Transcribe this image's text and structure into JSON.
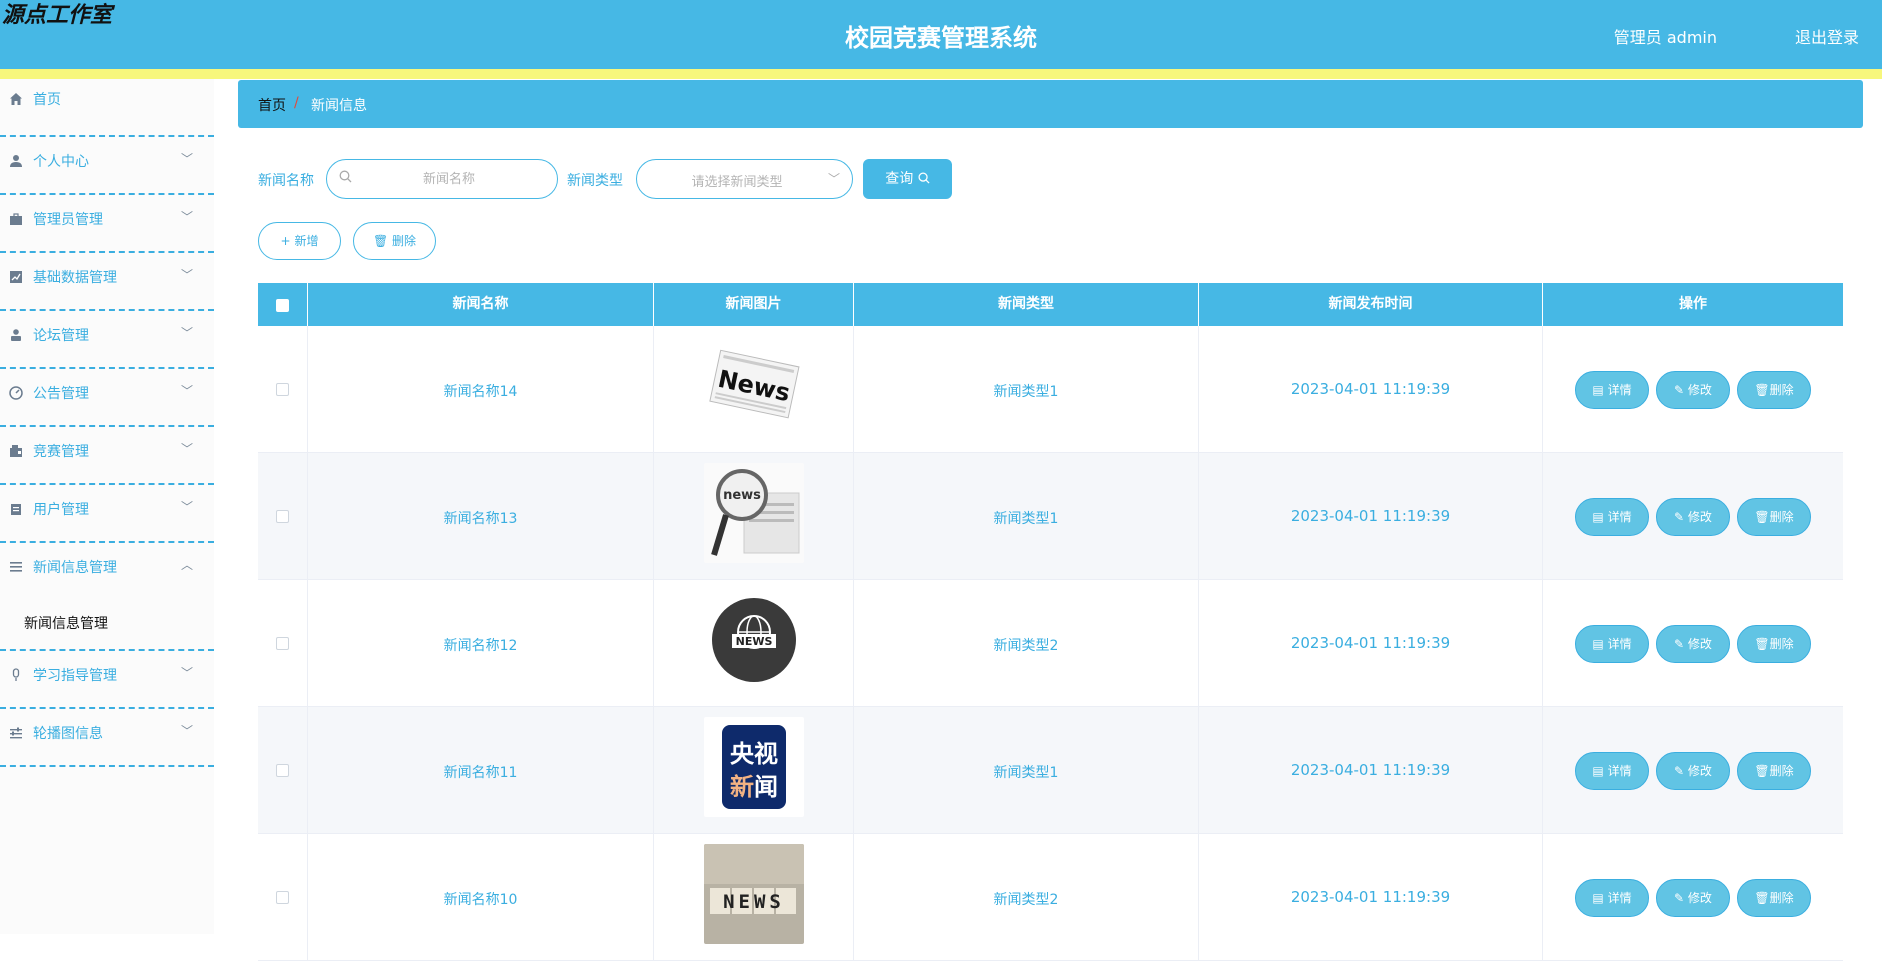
{
  "header": {
    "brand": "源点工作室",
    "title": "校园竞赛管理系统",
    "user": "管理员 admin",
    "logout": "退出登录"
  },
  "sidebar": {
    "items": [
      {
        "label": "首页",
        "icon": "home-icon"
      },
      {
        "label": "个人中心",
        "icon": "user-icon"
      },
      {
        "label": "管理员管理",
        "icon": "briefcase-icon"
      },
      {
        "label": "基础数据管理",
        "icon": "chart-icon"
      },
      {
        "label": "论坛管理",
        "icon": "person-icon"
      },
      {
        "label": "公告管理",
        "icon": "gauge-icon"
      },
      {
        "label": "竞赛管理",
        "icon": "wallet-icon"
      },
      {
        "label": "用户管理",
        "icon": "clipboard-icon"
      },
      {
        "label": "新闻信息管理",
        "icon": "list-icon"
      },
      {
        "label": "学习指导管理",
        "icon": "mic-icon"
      },
      {
        "label": "轮播图信息",
        "icon": "sliders-icon"
      }
    ],
    "subitem": "新闻信息管理"
  },
  "breadcrumb": {
    "home": "首页",
    "separator": "/",
    "current": "新闻信息"
  },
  "search": {
    "name_label": "新闻名称",
    "name_placeholder": "新闻名称",
    "type_label": "新闻类型",
    "type_placeholder": "请选择新闻类型",
    "query_label": "查询"
  },
  "toolbar": {
    "add_label": "新增",
    "delete_label": "删除"
  },
  "table": {
    "columns": [
      "新闻名称",
      "新闻图片",
      "新闻类型",
      "新闻发布时间",
      "操作"
    ],
    "rows": [
      {
        "name": "新闻名称14",
        "type": "新闻类型1",
        "time": "2023-04-01 11:19:39",
        "image": "news-paper"
      },
      {
        "name": "新闻名称13",
        "type": "新闻类型1",
        "time": "2023-04-01 11:19:39",
        "image": "news-magnifier"
      },
      {
        "name": "新闻名称12",
        "type": "新闻类型2",
        "time": "2023-04-01 11:19:39",
        "image": "news-globe"
      },
      {
        "name": "新闻名称11",
        "type": "新闻类型1",
        "time": "2023-04-01 11:19:39",
        "image": "cctv-news"
      },
      {
        "name": "新闻名称10",
        "type": "新闻类型2",
        "time": "2023-04-01 11:19:39",
        "image": "news-cubes"
      }
    ],
    "actions": {
      "detail": "详情",
      "edit": "修改",
      "delete": "删除"
    },
    "cctv_logo": {
      "line1": "央视",
      "line2a": "新",
      "line2b": "闻"
    },
    "news_word": "NEWS",
    "news_word_lower": "news",
    "news_word_title": "News"
  },
  "colors": {
    "primary": "#46b8e5",
    "accent_text": "#3aaee0",
    "yellow_strip": "#f7f77c"
  }
}
